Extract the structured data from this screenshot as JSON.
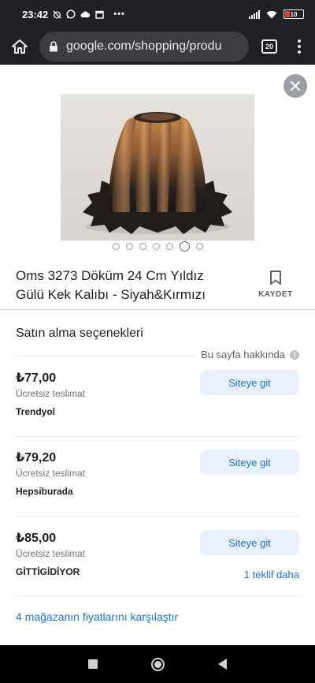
{
  "status_bar": {
    "time": "23:42",
    "dots": "•••",
    "battery": "10",
    "battery_color": "#e53935"
  },
  "browser": {
    "url": "google.com/shopping/produ",
    "tab_count": "20"
  },
  "carousel": {
    "total": 7,
    "active_index": 5
  },
  "product": {
    "title": "Oms 3273 Döküm 24 Cm Yıldız Gülü Kek Kalıbı - Siyah&Kırmızı",
    "save_label": "KAYDET"
  },
  "purchase": {
    "section_title": "Satın alma seçenekleri",
    "about_page": "Bu sayfa hakkında",
    "info_icon": "i",
    "offers": [
      {
        "price": "₺77,00",
        "delivery": "Ücretsiz teslimat",
        "store": "Trendyol",
        "button": "Siteye git"
      },
      {
        "price": "₺79,20",
        "delivery": "Ücretsiz teslimat",
        "store": "Hepsiburada",
        "button": "Siteye git"
      },
      {
        "price": "₺85,00",
        "delivery": "Ücretsiz teslimat",
        "store": "GİTTİGİDİYOR",
        "button": "Siteye git"
      }
    ],
    "more_offers": "1 teklif daha",
    "compare": "4 mağazanın fiyatlarını karşılaştır"
  },
  "colors": {
    "accent": "#1a73e8",
    "button_bg": "#e8f0fe",
    "toolbar_bg": "#202124"
  }
}
